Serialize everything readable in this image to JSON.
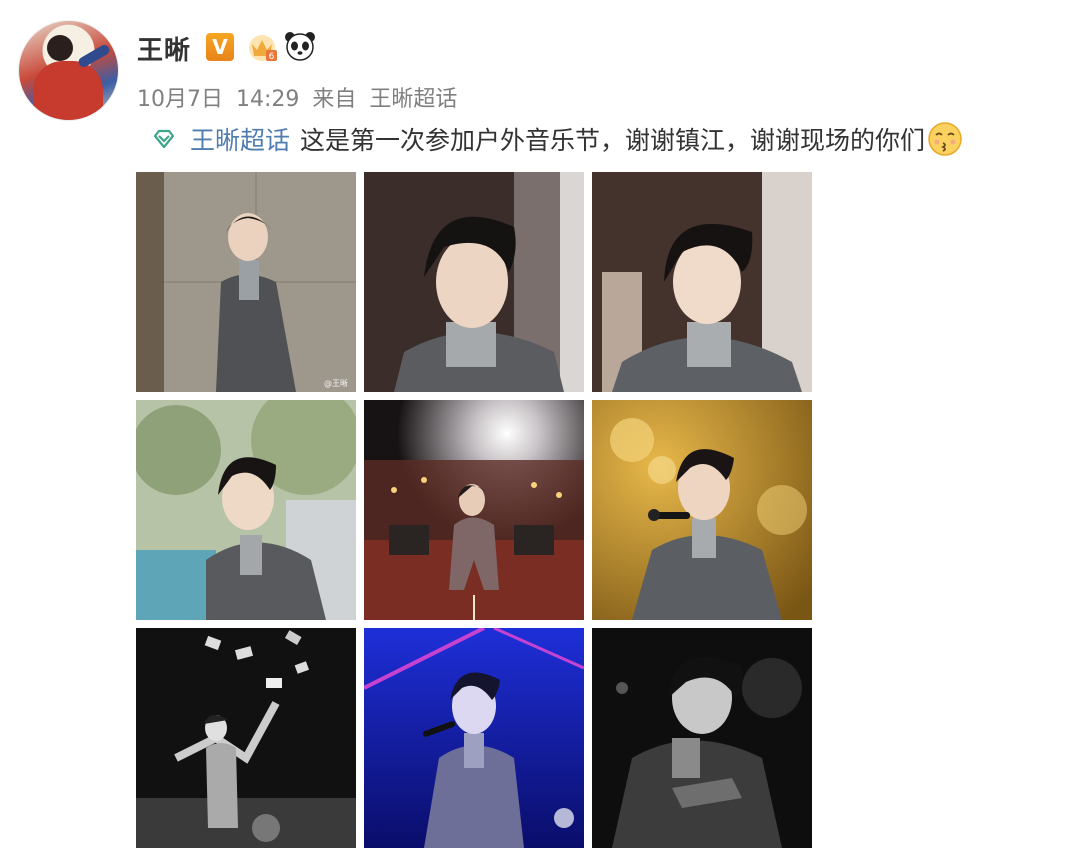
{
  "post": {
    "username": "王晰",
    "verified_badge": "V",
    "badges": [
      "crown-level-icon",
      "panda-icon"
    ],
    "date": "10月7日",
    "time": "14:29",
    "source_prefix": "来自",
    "source": "王晰超话",
    "topic_link": "王晰超话",
    "text": "这是第一次参加户外音乐节，谢谢镇江，谢谢现场的你们",
    "images": [
      {
        "name": "photo-1",
        "watermark": "@王晰"
      },
      {
        "name": "photo-2"
      },
      {
        "name": "photo-3"
      },
      {
        "name": "photo-4"
      },
      {
        "name": "photo-5"
      },
      {
        "name": "photo-6"
      },
      {
        "name": "photo-7"
      },
      {
        "name": "photo-8"
      },
      {
        "name": "photo-9"
      }
    ]
  },
  "colors": {
    "link": "#507daf",
    "meta": "#808080",
    "text": "#333333",
    "verified": "#f39c12"
  }
}
